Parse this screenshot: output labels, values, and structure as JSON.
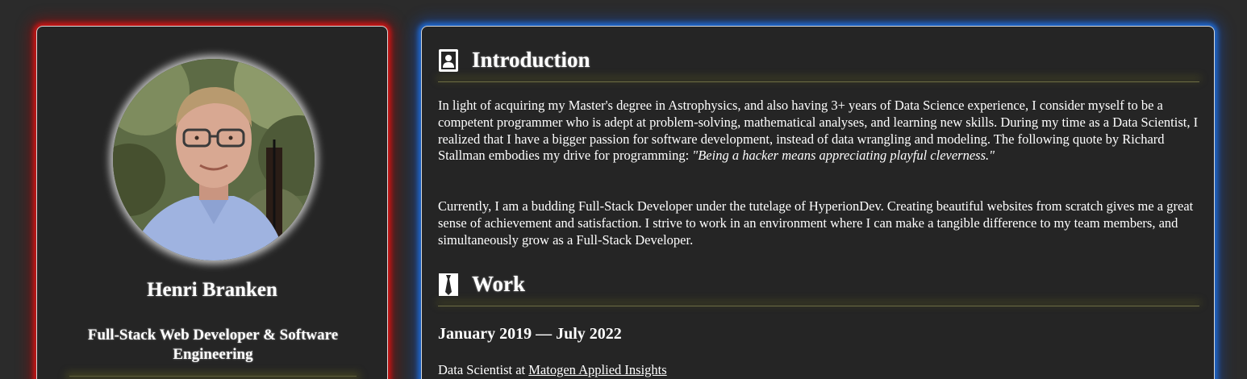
{
  "profile": {
    "name": "Henri Branken",
    "role": "Full-Stack Web Developer & Software Engineering"
  },
  "introduction": {
    "heading": "Introduction",
    "icon": "contact-card-icon",
    "paragraph1": "In light of acquiring my Master's degree in Astrophysics, and also having 3+ years of Data Science experience, I consider myself to be a competent programmer who is adept at problem-solving, mathematical analyses, and learning new skills. During my time as a Data Scientist, I realized that I have a bigger passion for software development, instead of data wrangling and modeling. The following quote by Richard Stallman embodies my drive for programming: ",
    "quote": "\"Being a hacker means appreciating playful cleverness.\"",
    "paragraph2": "Currently, I am a budding Full-Stack Developer under the tutelage of HyperionDev. Creating beautiful websites from scratch gives me a great sense of achievement and satisfaction. I strive to work in an environment where I can make a tangible difference to my team members, and simultaneously grow as a Full-Stack Developer."
  },
  "work": {
    "heading": "Work",
    "icon": "tie-icon",
    "dates": "January 2019 — July 2022",
    "role_prefix": "Data Scientist at ",
    "company": "Matogen Applied Insights"
  },
  "colors": {
    "background": "#2b2b2b",
    "card": "#252525",
    "profile_glow": "#dc1414",
    "content_glow": "#1e6edc",
    "heading_glow": "#82821e"
  }
}
